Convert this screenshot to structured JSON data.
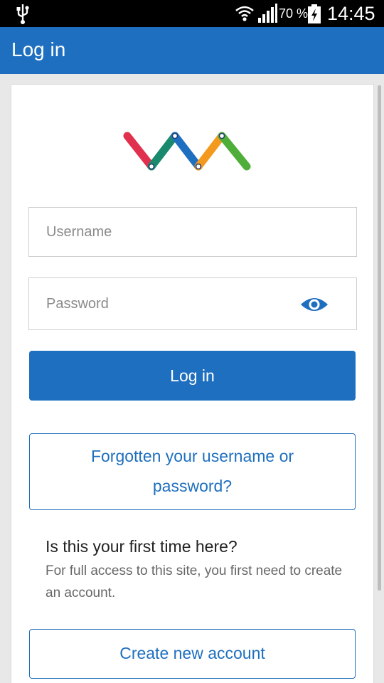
{
  "status_bar": {
    "battery_percent": "70 %",
    "time": "14:45",
    "icons": [
      "usb-icon",
      "wifi-icon",
      "signal-icon",
      "battery-charging-icon"
    ]
  },
  "app_bar": {
    "title": "Log in"
  },
  "login_form": {
    "username_placeholder": "Username",
    "password_placeholder": "Password",
    "password_toggle_icon": "eye-icon",
    "login_button": "Log in",
    "forgot_button": "Forgotten your username or password?"
  },
  "signup": {
    "heading": "Is this your first time here?",
    "description": "For full access to this site, you first need to create an account.",
    "create_button": "Create new account"
  },
  "colors": {
    "primary": "#1e6fbf",
    "logo": [
      "#e0304e",
      "#1a8a6e",
      "#1e6fbf",
      "#f39a1e",
      "#4fae3a"
    ]
  }
}
